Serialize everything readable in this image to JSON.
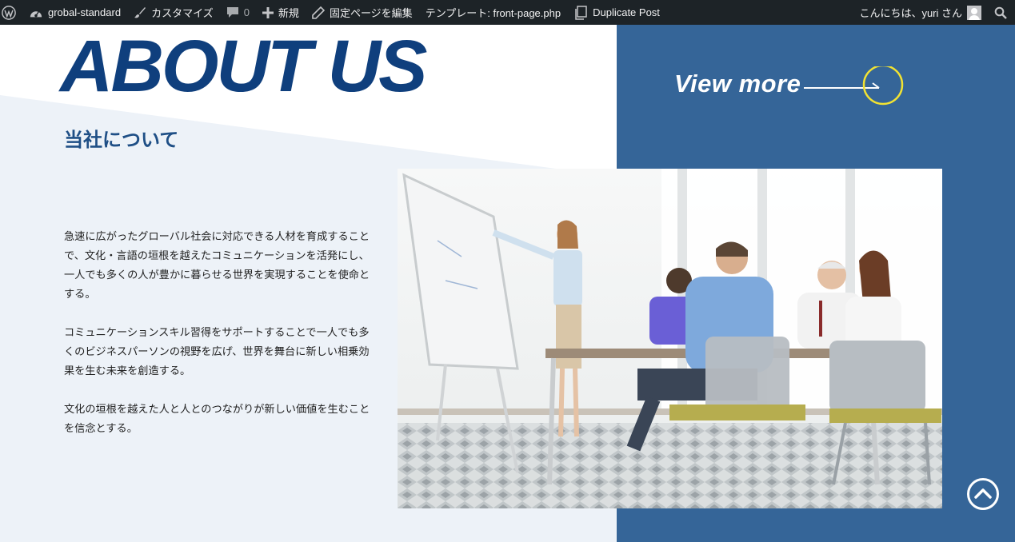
{
  "adminbar": {
    "site_name": "grobal-standard",
    "customize": "カスタマイズ",
    "comments_count": "0",
    "new": "新規",
    "edit_page": "固定ページを編集",
    "template": "テンプレート: front-page.php",
    "duplicate_post": "Duplicate Post",
    "greeting": "こんにちは、yuri さん"
  },
  "hero": {
    "heading_en": "ABOUT US",
    "heading_ja": "当社について",
    "view_more": "View more"
  },
  "about": {
    "paragraphs": [
      "急速に広がったグローバル社会に対応できる人材を育成することで、文化・言語の垣根を越えたコミュニケーションを活発にし、一人でも多くの人が豊かに暮らせる世界を実現することを使命とする。",
      "コミュニケーションスキル習得をサポートすることで一人でも多くのビジネスパーソンの視野を広げ、世界を舞台に新しい相乗効果を生む未来を創造する。",
      "文化の垣根を越えた人と人とのつながりが新しい価値を生むことを信念とする。"
    ]
  },
  "colors": {
    "admin_bar": "#1d2327",
    "brand_navy": "#0f3f7d",
    "panel_blue": "#356598",
    "light_bg": "#edf2f8",
    "accent_yellow": "#f2e332"
  },
  "icons": {
    "wp_logo": "wordpress-icon",
    "dashboard": "dashboard-icon",
    "customize": "paintbrush-icon",
    "comments": "comment-icon",
    "new": "plus-icon",
    "edit": "pencil-icon",
    "duplicate": "duplicate-icon",
    "search": "search-icon",
    "scroll_top": "chevron-up-circle-icon"
  }
}
